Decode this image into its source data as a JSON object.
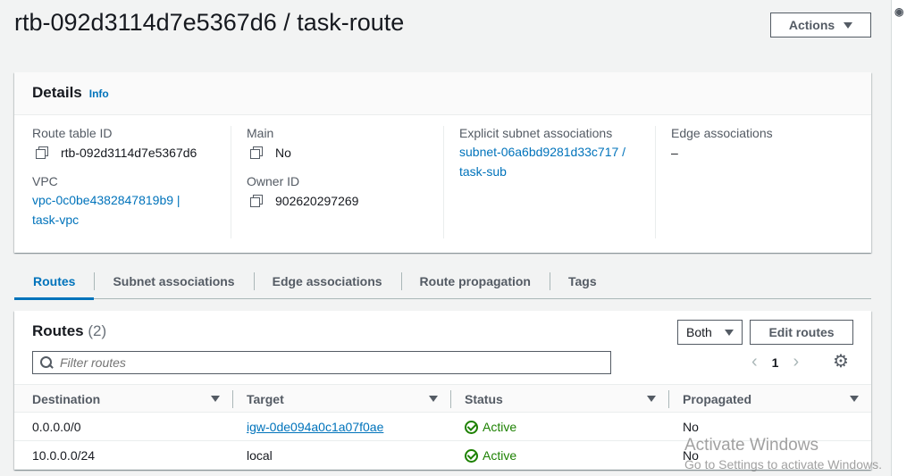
{
  "page": {
    "title": "rtb-092d3114d7e5367d6 / task-route",
    "actions_label": "Actions"
  },
  "details": {
    "heading": "Details",
    "info_label": "Info",
    "route_table_id_label": "Route table ID",
    "route_table_id": "rtb-092d3114d7e5367d6",
    "vpc_label": "VPC",
    "vpc_line1": "vpc-0c0be4382847819b9 |",
    "vpc_line2": "task-vpc",
    "main_label": "Main",
    "main_value": "No",
    "owner_label": "Owner ID",
    "owner_value": "902620297269",
    "subnet_label": "Explicit subnet associations",
    "subnet_line1": "subnet-06a6bd9281d33c717 /",
    "subnet_line2": "task-sub",
    "edge_label": "Edge associations",
    "edge_value": "–"
  },
  "tabs": [
    {
      "label": "Routes",
      "active": true
    },
    {
      "label": "Subnet associations"
    },
    {
      "label": "Edge associations"
    },
    {
      "label": "Route propagation"
    },
    {
      "label": "Tags"
    }
  ],
  "routes": {
    "title": "Routes",
    "count": "(2)",
    "filter_select": "Both",
    "edit_label": "Edit routes",
    "filter_placeholder": "Filter routes",
    "page_number": "1",
    "columns": [
      "Destination",
      "Target",
      "Status",
      "Propagated"
    ],
    "rows": [
      {
        "destination": "0.0.0.0/0",
        "target": "igw-0de094a0c1a07f0ae",
        "target_is_link": true,
        "status": "Active",
        "propagated": "No"
      },
      {
        "destination": "10.0.0.0/24",
        "target": "local",
        "target_is_link": false,
        "status": "Active",
        "propagated": "No"
      }
    ]
  },
  "watermark": {
    "title": "Activate Windows",
    "subtitle": "Go to Settings to activate Windows."
  },
  "icons": {
    "copy": "copy-icon",
    "search": "search-icon",
    "settings": "gear-icon",
    "status": "check-circle-icon"
  },
  "colors": {
    "link": "#0073bb",
    "success": "#1d8102",
    "background": "#f2f3f3"
  }
}
